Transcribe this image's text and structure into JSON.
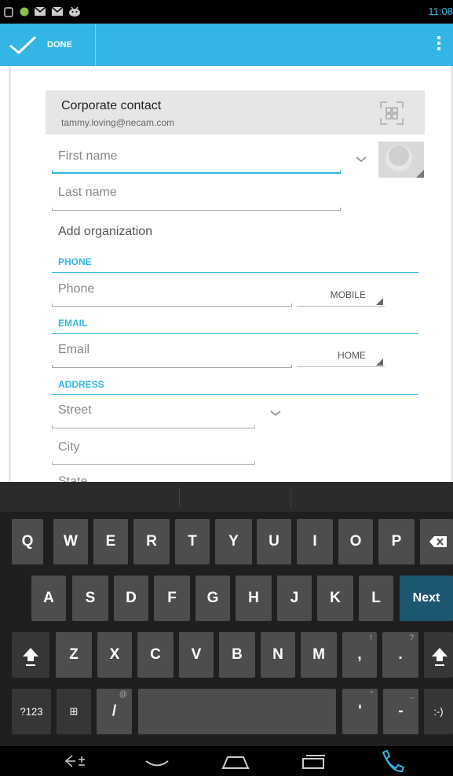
{
  "status_bar": {
    "time": "11:08",
    "icons": [
      "square-notification-icon",
      "circle-notification-icon",
      "gmail-icon",
      "gmail-icon",
      "android-icon"
    ]
  },
  "action_bar": {
    "done_label": "DONE"
  },
  "account": {
    "name": "Corporate contact",
    "email": "tammy.loving@necam.com"
  },
  "fields": {
    "first_name_placeholder": "First name",
    "last_name_placeholder": "Last name",
    "add_organization": "Add organization",
    "phone_section": "PHONE",
    "phone_placeholder": "Phone",
    "phone_type": "MOBILE",
    "email_section": "EMAIL",
    "email_placeholder": "Email",
    "email_type": "HOME",
    "address_section": "ADDRESS",
    "street_placeholder": "Street",
    "city_placeholder": "City",
    "state_placeholder": "State"
  },
  "keyboard": {
    "row1": [
      "Q",
      "W",
      "E",
      "R",
      "T",
      "Y",
      "U",
      "I",
      "O",
      "P"
    ],
    "row2": [
      "A",
      "S",
      "D",
      "F",
      "G",
      "H",
      "J",
      "K",
      "L"
    ],
    "row2_action": "Next",
    "row3": [
      "Z",
      "X",
      "C",
      "V",
      "B",
      "N",
      "M"
    ],
    "row3_hints": {
      "comma": "!",
      "period": "?"
    },
    "comma": ",",
    "period": ".",
    "mode_key": "?123",
    "settings_key": "⊞",
    "slash": "/",
    "slash_hint": "@",
    "apostrophe": "'",
    "apostrophe_hint": "\"",
    "dash": "-",
    "dash_hint": "_",
    "smiley": ":-)"
  },
  "colors": {
    "accent": "#33b5e5",
    "keyboard_bg": "#1f1f1f",
    "key_bg": "#4d4d4d",
    "next_key_bg": "#1c5670"
  }
}
